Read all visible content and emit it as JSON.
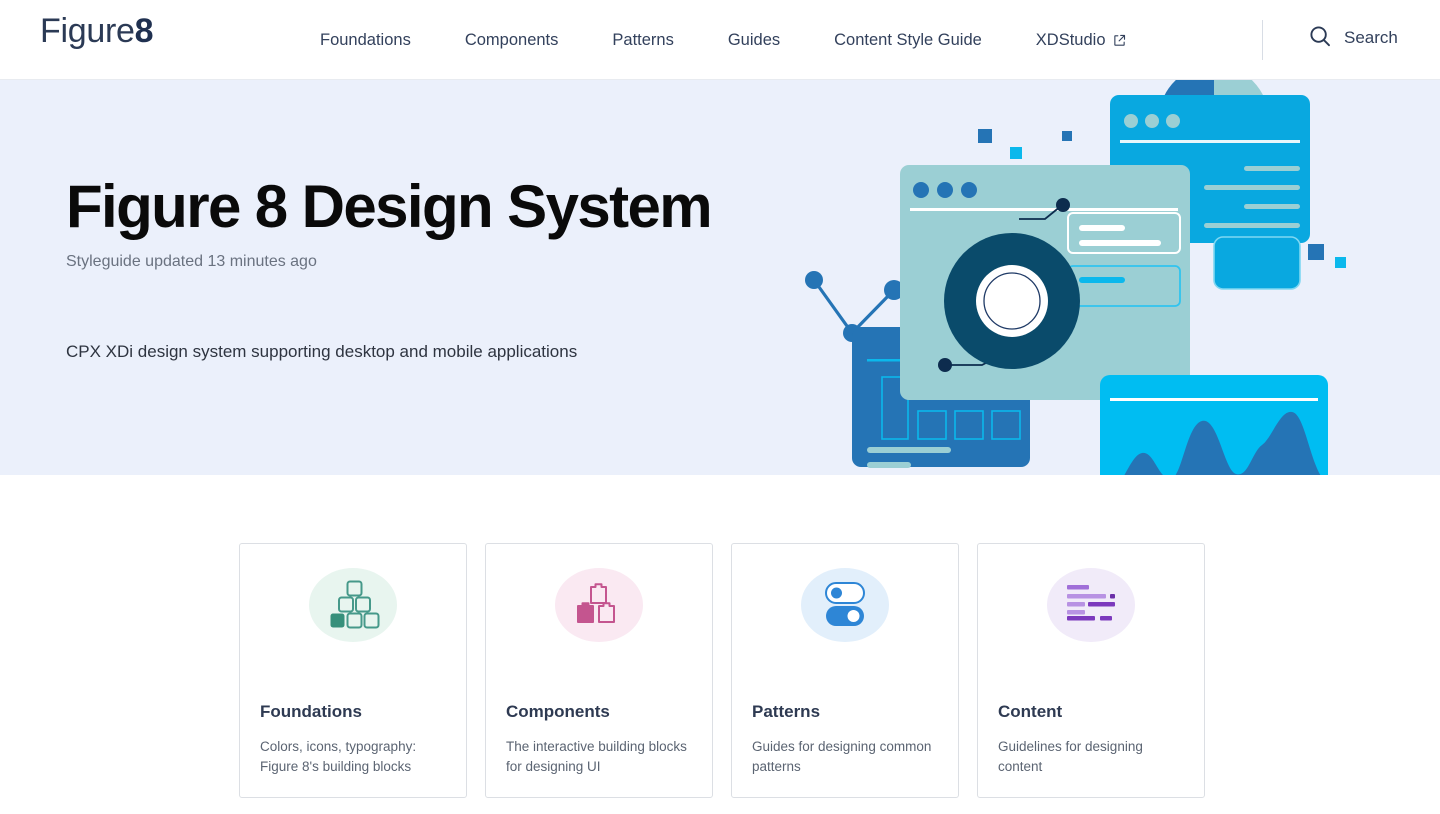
{
  "navbar": {
    "brand_prefix": "Figure",
    "brand_suffix": "8",
    "links": [
      {
        "label": "Foundations",
        "external": false
      },
      {
        "label": "Components",
        "external": false
      },
      {
        "label": "Patterns",
        "external": false
      },
      {
        "label": "Guides",
        "external": false
      },
      {
        "label": "Content Style Guide",
        "external": false
      },
      {
        "label": "XDStudio",
        "external": true
      }
    ],
    "search_label": "Search",
    "search_icon": "search-icon",
    "external_link_icon": "external-link-icon"
  },
  "hero": {
    "title": "Figure 8 Design System",
    "updated": "Styleguide updated 13 minutes ago",
    "description": "CPX XDi design system supporting desktop and mobile applications",
    "background_color": "#ebf0fb",
    "illustration_name": "design-system-dashboard-illustration"
  },
  "cards": [
    {
      "title": "Foundations",
      "description": "Colors, icons, typography: Figure 8's building blocks",
      "icon": "building-blocks-icon",
      "circle_color": "#e8f5ef",
      "accent_color": "#37907b"
    },
    {
      "title": "Components",
      "description": "The interactive building blocks for designing UI",
      "icon": "lego-bricks-icon",
      "circle_color": "#fae9f2",
      "accent_color": "#c4558f"
    },
    {
      "title": "Patterns",
      "description": "Guides for designing common patterns",
      "icon": "toggles-icon",
      "circle_color": "#e2effb",
      "accent_color": "#2e86d6"
    },
    {
      "title": "Content",
      "description": "Guidelines for designing content",
      "icon": "text-lines-icon",
      "circle_color": "#f1ebf9",
      "accent_color": "#8540c9"
    }
  ]
}
